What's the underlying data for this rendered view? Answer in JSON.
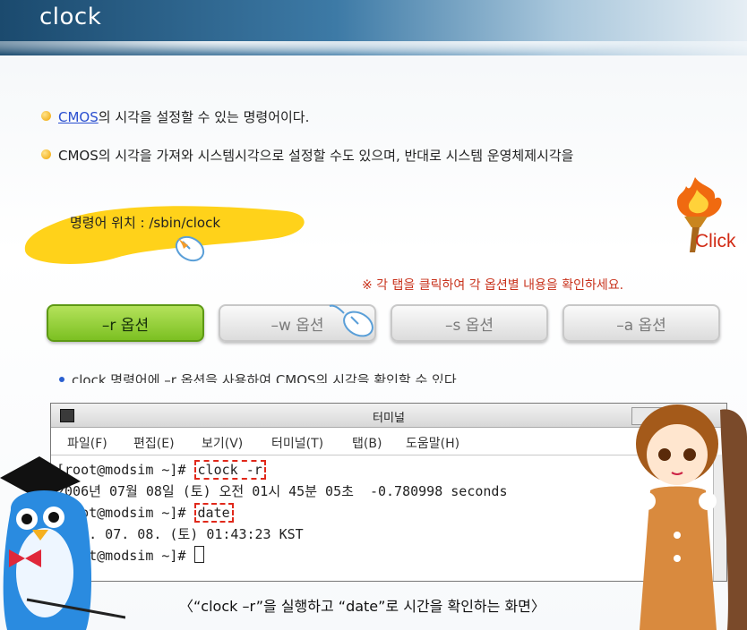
{
  "header": {
    "title": "clock"
  },
  "bullets": {
    "b1_link": "CMOS",
    "b1_text": "의 시각을 설정할 수 있는 명령어이다.",
    "b2_text": "CMOS의 시각을 가져와 시스템시각으로 설정할 수도 있으며, 반대로 시스템 운영체제시각을"
  },
  "location": {
    "label": "명령어 위치 : /sbin/clock"
  },
  "click_label": "Click",
  "notice": "※ 각 탭을 클릭하여 각 옵션별 내용을 확인하세요.",
  "tabs": [
    {
      "label": "–r 옵션",
      "active": true
    },
    {
      "label": "–w 옵션",
      "active": false
    },
    {
      "label": "–s 옵션",
      "active": false
    },
    {
      "label": "–a 옵션",
      "active": false
    }
  ],
  "tab_description": "clock 명령어에 –r 옵션을 사용하여 CMOS의 시각을 확인할 수 있다",
  "terminal": {
    "title": "터미널",
    "menu": [
      "파일(F)",
      "편집(E)",
      "보기(V)",
      "터미널(T)",
      "탭(B)",
      "도움말(H)"
    ],
    "line1_prompt": "[root@modsim ~]# ",
    "line1_cmd": "clock -r",
    "line2": "2006년 07월 08일 (토) 오전 01시 45분 05초  -0.780998 seconds",
    "line3_prompt": "[root@modsim ~]# ",
    "line3_cmd": "date",
    "line4": "2006. 07. 08. (토) 01:43:23 KST",
    "line5_prompt": "[root@modsim ~]# "
  },
  "caption": "〈“clock –r”을 실행하고 “date”로 시간을 확인하는 화면〉",
  "colors": {
    "accent_green": "#7cc022",
    "notice_red": "#c8321c",
    "link_blue": "#2a4fd0"
  }
}
